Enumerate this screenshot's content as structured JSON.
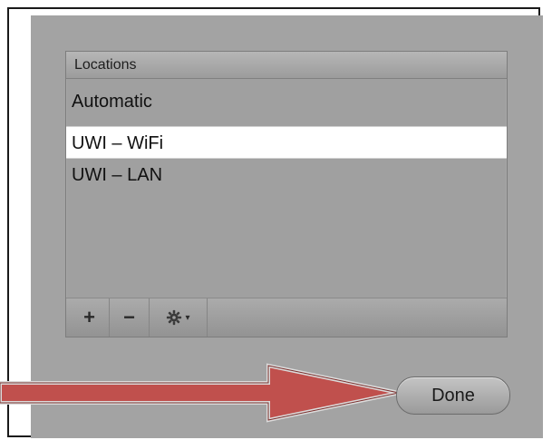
{
  "locations_panel": {
    "header": "Locations",
    "items": [
      {
        "label": "Automatic",
        "selected": false
      },
      {
        "label": "UWI – WiFi",
        "selected": true
      },
      {
        "label": "UWI – LAN",
        "selected": false
      }
    ]
  },
  "toolbar": {
    "add_label": "+",
    "remove_label": "−",
    "gear_icon": "gear-icon",
    "gear_caret": "▾"
  },
  "done_button": {
    "label": "Done"
  },
  "colors": {
    "sheet_bg": "#a3a3a3",
    "selection_bg": "#ffffff",
    "arrow_fill": "#c0504d"
  }
}
